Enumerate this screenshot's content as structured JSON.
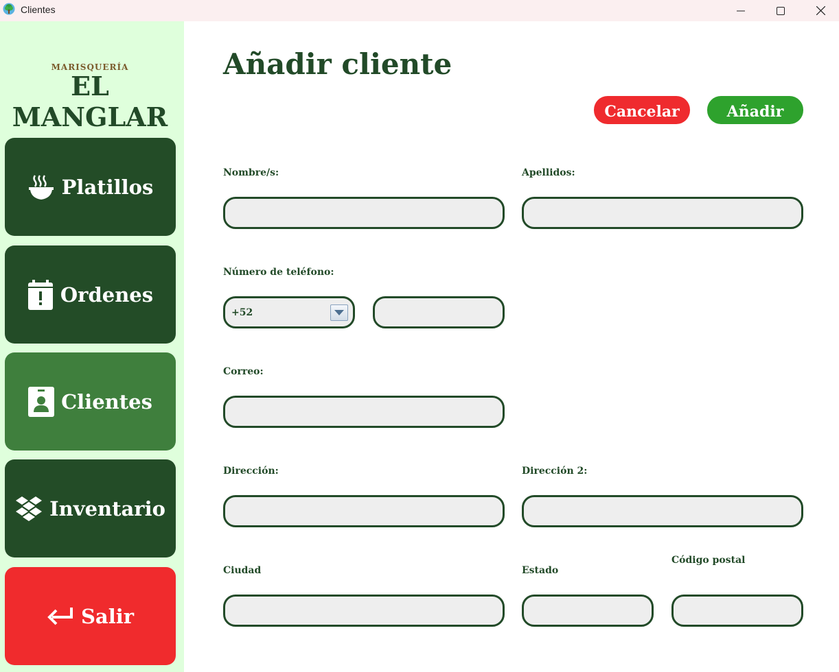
{
  "window": {
    "title": "Clientes"
  },
  "sidebar": {
    "brand_small": "MARISQUERÍA",
    "brand_big": "EL MANGLAR",
    "items": [
      {
        "label": "Platillos",
        "icon": "bowl-icon"
      },
      {
        "label": "Ordenes",
        "icon": "calendar-alert-icon"
      },
      {
        "label": "Clientes",
        "icon": "contact-card-icon"
      },
      {
        "label": "Inventario",
        "icon": "boxes-icon"
      },
      {
        "label": "Salir",
        "icon": "return-arrow-icon"
      }
    ],
    "active": "Clientes"
  },
  "main": {
    "title": "Añadir cliente",
    "cancel_label": "Cancelar",
    "add_label": "Añadir",
    "labels": {
      "nombres": "Nombre/s:",
      "apellidos": "Apellidos:",
      "telefono": "Número de teléfono:",
      "correo": "Correo:",
      "direccion": "Dirección:",
      "direccion2": "Dirección 2:",
      "ciudad": "Ciudad",
      "estado": "Estado",
      "codigo_postal": "Código postal"
    },
    "values": {
      "nombres": "",
      "apellidos": "",
      "country_code": "+52",
      "telefono": "",
      "correo": "",
      "direccion": "",
      "direccion2": "",
      "ciudad": "",
      "estado": "",
      "codigo_postal": ""
    }
  },
  "colors": {
    "dark_green": "#234c27",
    "active_green": "#3f7f3d",
    "add_green": "#2ea22d",
    "red": "#ef2b2e",
    "sidebar_bg": "#dfffdc",
    "field_bg": "#eeeeee",
    "brand_brown": "#7b5b2c"
  }
}
